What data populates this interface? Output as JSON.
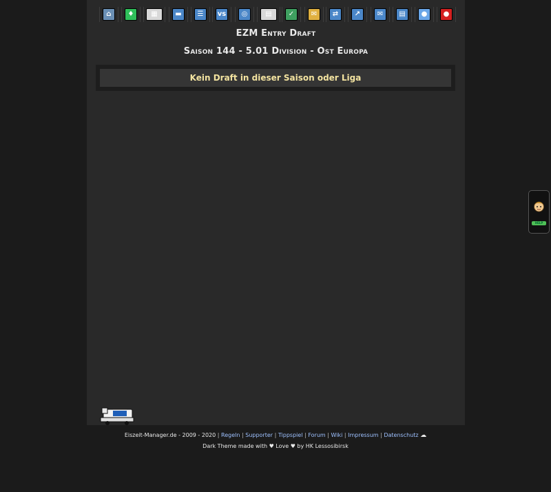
{
  "toolbar": {
    "items": [
      {
        "name": "home-icon",
        "glyph": "⌂",
        "color": "#6a8fb5"
      },
      {
        "name": "jersey-icon",
        "glyph": "♦",
        "color": "#2fbf5a"
      },
      {
        "name": "lineup-icon",
        "glyph": "▦",
        "color": "#d8d8d8"
      },
      {
        "name": "training-icon",
        "glyph": "▬",
        "color": "#4b87c8"
      },
      {
        "name": "list-icon",
        "glyph": "☰",
        "color": "#4b87c8"
      },
      {
        "name": "versus-icon",
        "glyph": "vs",
        "color": "#4b87c8"
      },
      {
        "name": "scout-icon",
        "glyph": "◎",
        "color": "#4b87c8"
      },
      {
        "name": "arena-icon",
        "glyph": "▤",
        "color": "#d8d8d8"
      },
      {
        "name": "league-icon",
        "glyph": "✓",
        "color": "#3fa060"
      },
      {
        "name": "finance-icon",
        "glyph": "✉",
        "color": "#e0b040"
      },
      {
        "name": "transfer-icon",
        "glyph": "⇄",
        "color": "#4b87c8"
      },
      {
        "name": "stats-icon",
        "glyph": "↗",
        "color": "#4b87c8"
      },
      {
        "name": "mail-icon",
        "glyph": "✉",
        "color": "#4b87c8"
      },
      {
        "name": "news-icon",
        "glyph": "▤",
        "color": "#4b87c8"
      },
      {
        "name": "chat-icon",
        "glyph": "●",
        "color": "#6aa6e8"
      },
      {
        "name": "logout-icon",
        "glyph": "●",
        "color": "#d42020"
      }
    ]
  },
  "title": "EZM Entry Draft",
  "subtitle": "Saison 144 - 5.01 Division - Ost Europa",
  "message": "Kein Draft in dieser Saison oder Liga",
  "footer": {
    "site": "Eiszeit-Manager.de - 2009 - 2020",
    "links": [
      "Regeln",
      "Supporter",
      "Tippspiel",
      "Forum",
      "Wiki",
      "Impressum",
      "Datenschutz"
    ],
    "credit": "Dark Theme made with ♥ Love ♥ by HK Lessosibirsk"
  },
  "side_widget": {
    "label": "HELP"
  }
}
